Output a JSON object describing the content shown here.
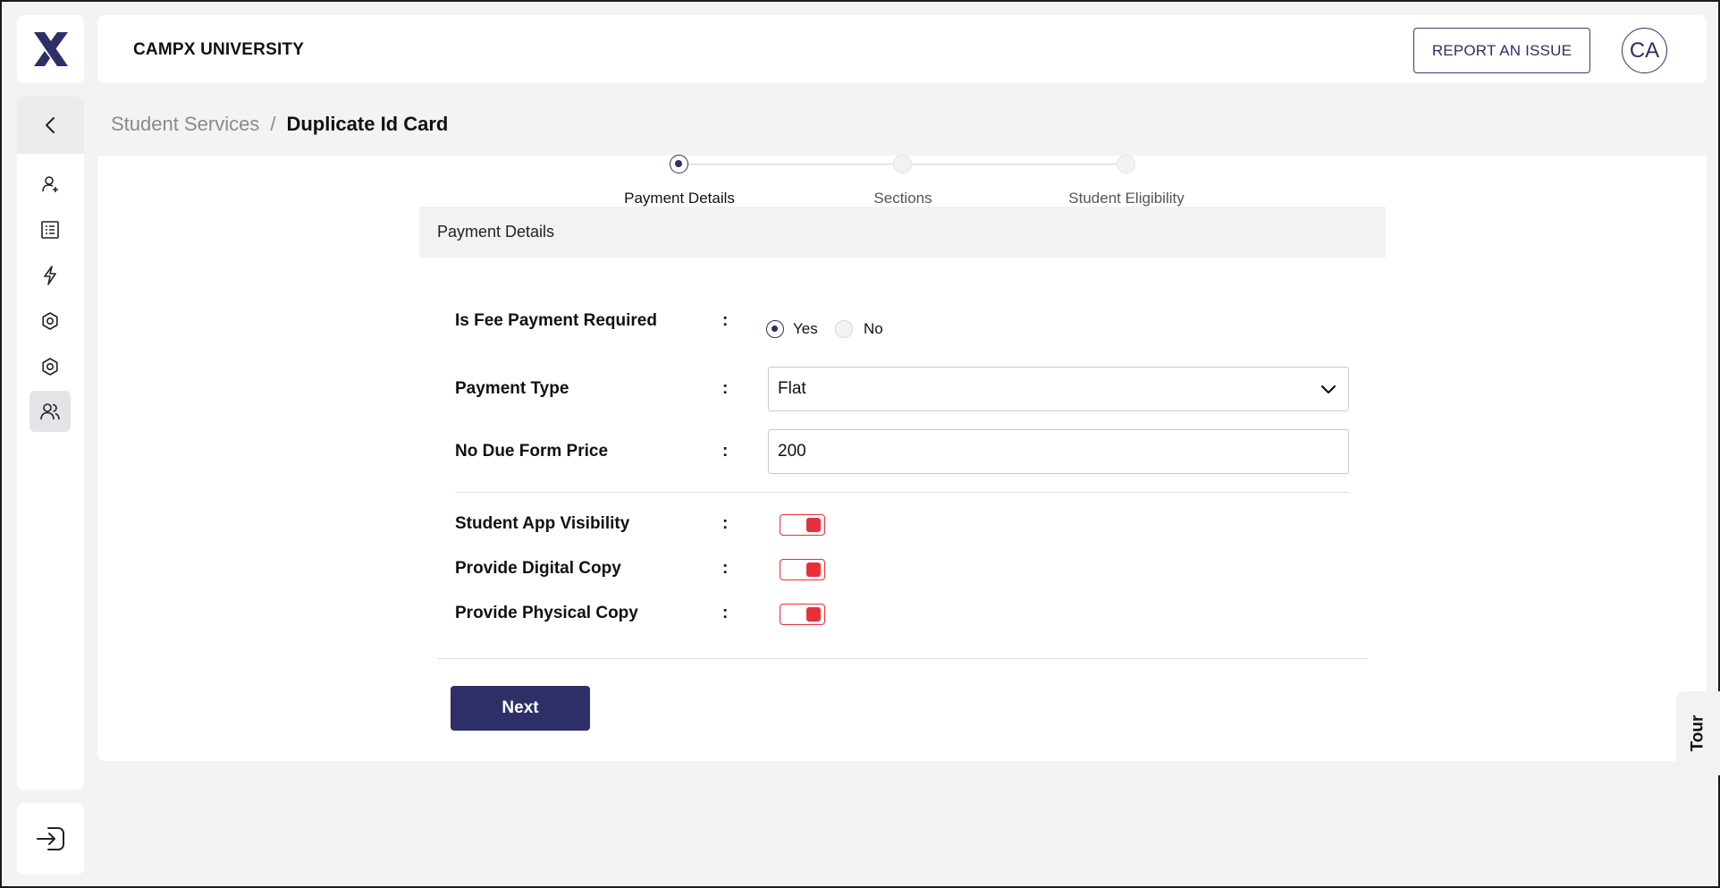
{
  "app": {
    "brand": "CAMPX UNIVERSITY",
    "report_label": "REPORT AN ISSUE",
    "avatar_initials": "CA"
  },
  "sidebar": {
    "items": [
      {
        "icon": "user-add-icon"
      },
      {
        "icon": "document-list-icon"
      },
      {
        "icon": "lightning-icon"
      },
      {
        "icon": "settings-icon"
      },
      {
        "icon": "settings-icon"
      },
      {
        "icon": "users-icon",
        "active": true
      }
    ]
  },
  "breadcrumb": {
    "parent": "Student Services",
    "separator": "/",
    "current": "Duplicate Id Card"
  },
  "stepper": {
    "steps": [
      "Payment Details",
      "Sections",
      "Student Eligibility"
    ],
    "active_index": 0
  },
  "section": {
    "title": "Payment Details"
  },
  "form": {
    "fee_required": {
      "label": "Is Fee Payment Required",
      "colon": ":",
      "options": [
        "Yes",
        "No"
      ],
      "selected": "Yes"
    },
    "payment_type": {
      "label": "Payment Type",
      "colon": ":",
      "value": "Flat"
    },
    "price": {
      "label": "No Due Form Price",
      "colon": ":",
      "value": "200"
    },
    "toggles": [
      {
        "label": "Student App Visibility",
        "colon": ":",
        "on": true
      },
      {
        "label": "Provide Digital Copy",
        "colon": ":",
        "on": true
      },
      {
        "label": "Provide Physical Copy",
        "colon": ":",
        "on": true
      }
    ]
  },
  "actions": {
    "next_label": "Next"
  },
  "tour": {
    "label": "Tour"
  },
  "colors": {
    "primary": "#2d2f66",
    "toggle_accent": "#e8303a",
    "background": "#f3f3f4"
  }
}
